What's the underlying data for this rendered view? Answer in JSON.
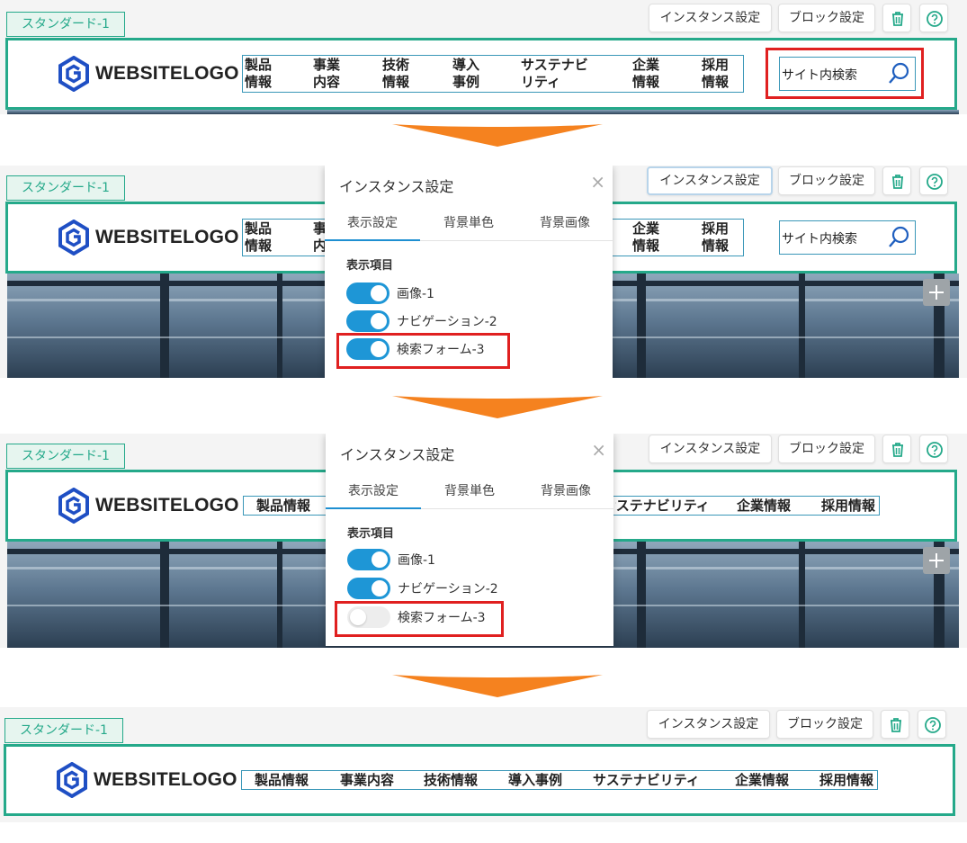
{
  "block_tag": "スタンダード-1",
  "toolbar": {
    "instance_settings": "インスタンス設定",
    "block_settings": "ブロック設定"
  },
  "logo_text": "WEBSITELOGO",
  "nav_wrapped": [
    {
      "l1": "製品",
      "l2": "情報"
    },
    {
      "l1": "事業",
      "l2": "内容"
    },
    {
      "l1": "技術",
      "l2": "情報"
    },
    {
      "l1": "導入",
      "l2": "事例"
    },
    {
      "l1": "サステナビ",
      "l2": "リティ"
    },
    {
      "l1": "企業",
      "l2": "情報"
    },
    {
      "l1": "採用",
      "l2": "情報"
    }
  ],
  "nav_full": [
    "製品情報",
    "事業内容",
    "技術情報",
    "導入事例",
    "サステナビリティ",
    "企業情報",
    "採用情報"
  ],
  "search": {
    "placeholder": "サイト内検索"
  },
  "dialog": {
    "title": "インスタンス設定",
    "close": "×",
    "tabs": [
      "表示設定",
      "背景単色",
      "背景画像"
    ],
    "section": "表示項目",
    "items": [
      "画像-1",
      "ナビゲーション-2",
      "検索フォーム-3"
    ]
  },
  "step2_toggles": [
    true,
    true,
    true
  ],
  "step3_toggles": [
    true,
    true,
    false
  ],
  "colors": {
    "accent_green": "#25a98a",
    "highlight_red": "#e02020",
    "toggle_blue": "#1e96d6",
    "arrow_orange": "#f5821f"
  },
  "icons": [
    "trash-icon",
    "help-icon",
    "search-icon",
    "close-icon",
    "plus-icon",
    "arrow-down-icon",
    "logo-hexagon-icon"
  ]
}
